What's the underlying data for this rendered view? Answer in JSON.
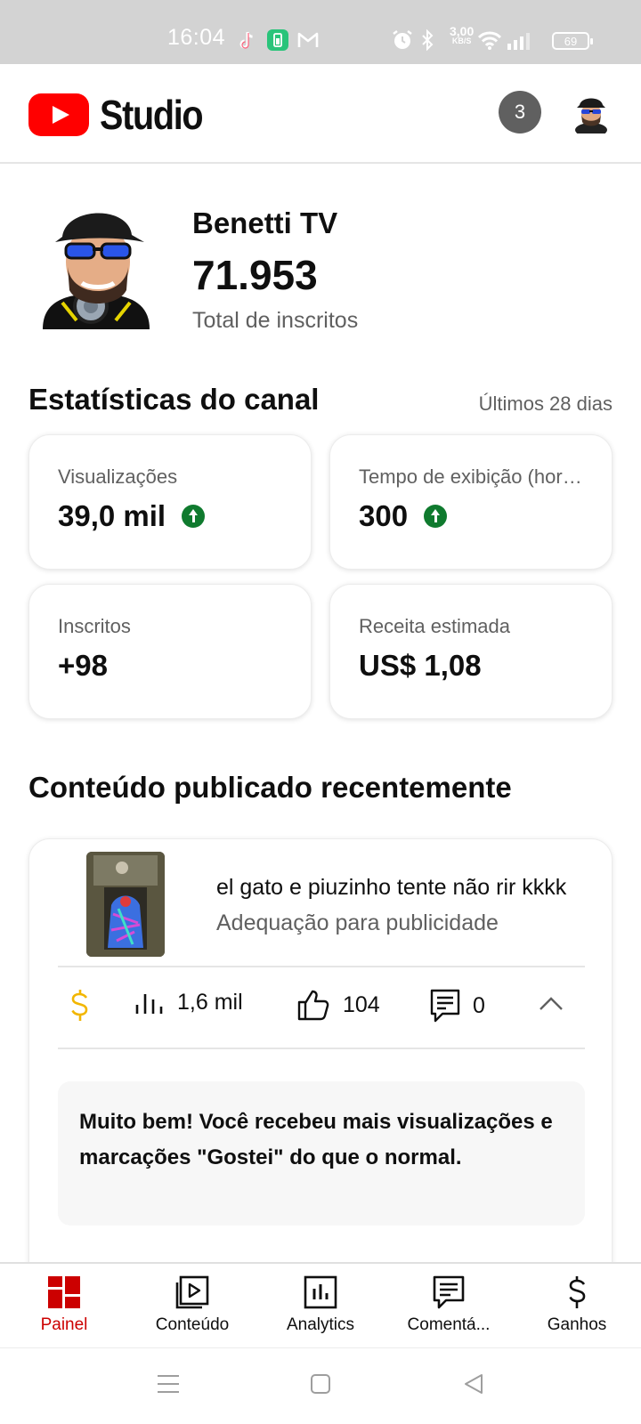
{
  "status_bar": {
    "time": "16:04",
    "net_speed_value": "3,00",
    "net_speed_unit": "KB/S",
    "battery": "69",
    "icons": [
      "tiktok-icon",
      "battery-saver-icon",
      "gmail-icon",
      "alarm-icon",
      "bluetooth-icon",
      "wifi-icon",
      "signal-icon"
    ]
  },
  "header": {
    "logo_text": "Studio",
    "notifications_count": "3",
    "brand_color": "#ff0000"
  },
  "channel": {
    "name": "Benetti TV",
    "subscribers": "71.953",
    "subscribers_label": "Total de inscritos"
  },
  "stats": {
    "title": "Estatísticas do canal",
    "range": "Últimos 28 dias",
    "cards": [
      {
        "label": "Visualizações",
        "value": "39,0 mil",
        "trend": "up"
      },
      {
        "label": "Tempo de exibição (horas)",
        "value": "300",
        "trend": "up"
      },
      {
        "label": "Inscritos",
        "value": "+98"
      },
      {
        "label": "Receita estimada",
        "value": "US$ 1,08"
      }
    ],
    "trend_color": "#0f7a2e"
  },
  "recent": {
    "title": "Conteúdo publicado recentemente",
    "video": {
      "title": "el gato e piuzinho tente não rir kkkk",
      "subtitle": "Adequação para publicidade",
      "views": "1,6 mil",
      "likes": "104",
      "comments": "0"
    },
    "message": "Muito bem! Você recebeu mais visualizações e marcações \"Gostei\" do que o normal.",
    "monetization_color": "#f2b600"
  },
  "bottom_nav": {
    "items": [
      {
        "label": "Painel",
        "icon": "dashboard-icon",
        "active": true
      },
      {
        "label": "Conteúdo",
        "icon": "content-icon"
      },
      {
        "label": "Analytics",
        "icon": "analytics-icon"
      },
      {
        "label": "Comentá...",
        "icon": "comments-icon"
      },
      {
        "label": "Ganhos",
        "icon": "earnings-icon"
      }
    ],
    "active_color": "#cc0000"
  }
}
